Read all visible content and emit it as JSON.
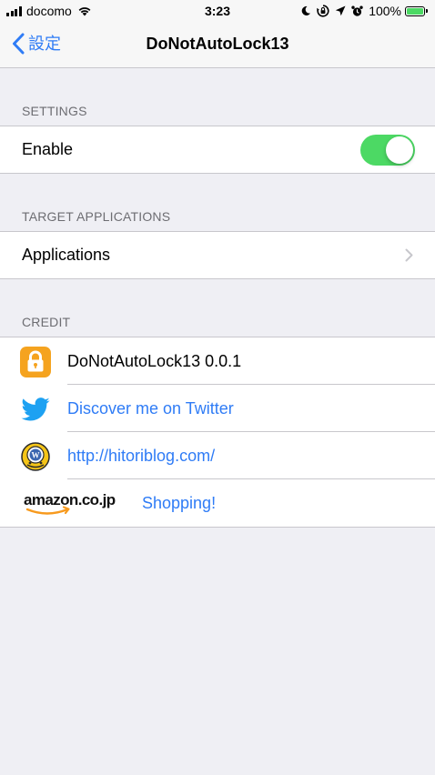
{
  "status_bar": {
    "carrier": "docomo",
    "time": "3:23",
    "battery_percent": "100%",
    "icons": [
      "cellular-signal-icon",
      "wifi-icon",
      "do-not-disturb-moon-icon",
      "orientation-lock-icon",
      "location-arrow-icon",
      "alarm-icon",
      "battery-charging-icon"
    ]
  },
  "nav": {
    "back_label": "設定",
    "title": "DoNotAutoLock13"
  },
  "settings": {
    "header": "SETTINGS",
    "enable_label": "Enable",
    "enable_on": true
  },
  "target": {
    "header": "TARGET APPLICATIONS",
    "applications_label": "Applications"
  },
  "credit": {
    "header": "CREDIT",
    "items": [
      {
        "icon": "lock-app-icon",
        "text": "DoNotAutoLock13 0.0.1",
        "link": false
      },
      {
        "icon": "twitter-bird-icon",
        "text": "Discover me on Twitter",
        "link": true
      },
      {
        "icon": "blog-logo-icon",
        "text": "http://hitoriblog.com/",
        "link": true
      },
      {
        "icon": "amazon-logo-icon",
        "logo_text": "amazon.co.jp",
        "text": "Shopping!",
        "link": true
      }
    ]
  },
  "colors": {
    "accent": "#2f7cf6",
    "toggle_on": "#4cd964",
    "background": "#efeff4",
    "header_text": "#6d6d72",
    "lock_icon_bg": "#f5a31f",
    "twitter_blue": "#1da1f2",
    "amazon_orange": "#f79a1e"
  }
}
